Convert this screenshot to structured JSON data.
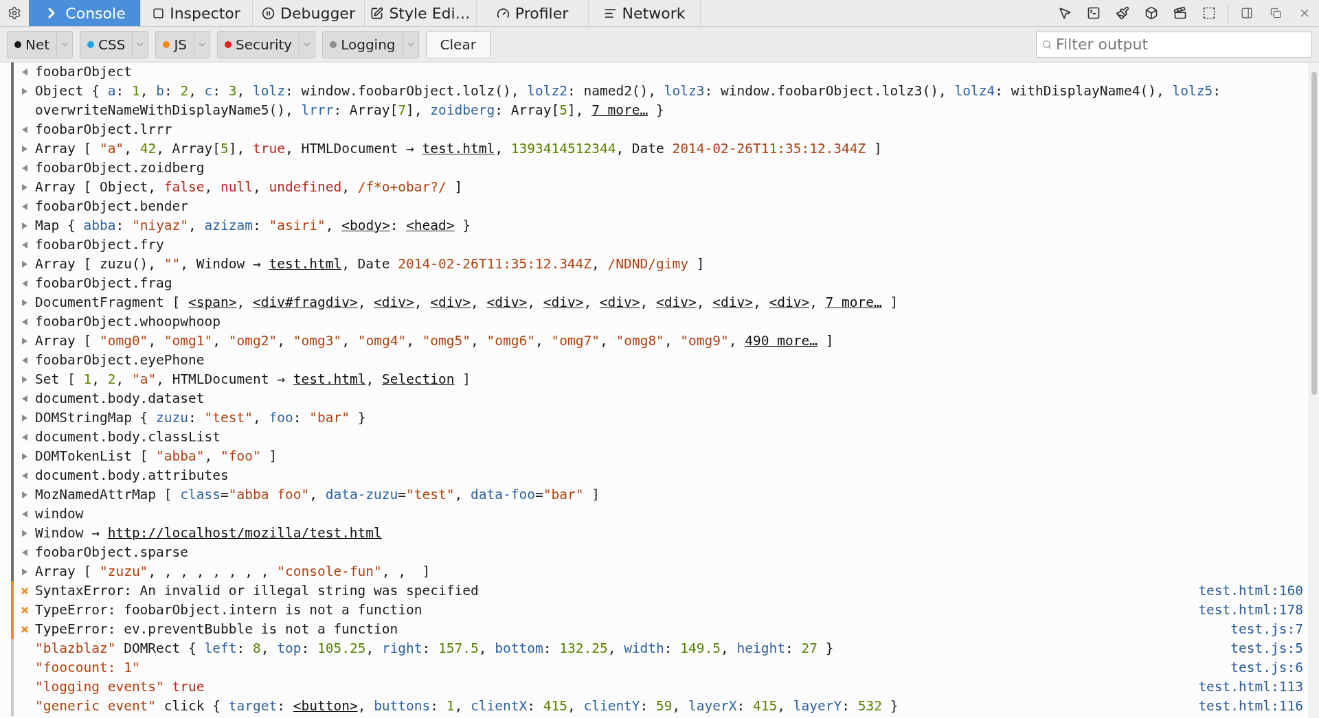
{
  "tabs": [
    {
      "label": "Console",
      "selected": true
    },
    {
      "label": "Inspector",
      "selected": false
    },
    {
      "label": "Debugger",
      "selected": false
    },
    {
      "label": "Style Edi…",
      "selected": false
    },
    {
      "label": "Profiler",
      "selected": false
    },
    {
      "label": "Network",
      "selected": false
    }
  ],
  "filters": [
    {
      "label": "Net",
      "color": "#1a1a1a"
    },
    {
      "label": "CSS",
      "color": "#1fa3e8"
    },
    {
      "label": "JS",
      "color": "#f08c1a"
    },
    {
      "label": "Security",
      "color": "#e8212b"
    },
    {
      "label": "Logging",
      "color": "#8c8c8c"
    }
  ],
  "clear_button": "Clear",
  "filter_field": {
    "placeholder": "Filter output"
  },
  "rows": [
    {
      "kind": "input",
      "parts": [
        {
          "text": "foobarObject"
        }
      ]
    },
    {
      "kind": "output",
      "parts": [
        {
          "text": "Object { "
        },
        {
          "key": "a"
        },
        {
          "text": ": "
        },
        {
          "number": "1"
        },
        {
          "text": ", "
        },
        {
          "key": "b"
        },
        {
          "text": ": "
        },
        {
          "number": "2"
        },
        {
          "text": ", "
        },
        {
          "key": "c"
        },
        {
          "text": ": "
        },
        {
          "number": "3"
        },
        {
          "text": ", "
        },
        {
          "key": "lolz"
        },
        {
          "text": ": window.foobarObject.lolz(), "
        },
        {
          "key": "lolz2"
        },
        {
          "text": ": named2(), "
        },
        {
          "key": "lolz3"
        },
        {
          "text": ": window.foobarObject.lolz3(), "
        },
        {
          "key": "lolz4"
        },
        {
          "text": ": withDisplayName4(), "
        },
        {
          "key": "lolz5"
        },
        {
          "text": ": overwriteNameWithDisplayName5(), "
        },
        {
          "key": "lrrr"
        },
        {
          "text": ": Array["
        },
        {
          "number": "7"
        },
        {
          "text": "], "
        },
        {
          "key": "zoidberg"
        },
        {
          "text": ": Array["
        },
        {
          "number": "5"
        },
        {
          "text": "], "
        },
        {
          "link": "7 more…"
        },
        {
          "text": " }"
        }
      ]
    },
    {
      "kind": "input",
      "parts": [
        {
          "text": "foobarObject.lrrr"
        }
      ]
    },
    {
      "kind": "output",
      "parts": [
        {
          "text": "Array [ "
        },
        {
          "string": "\"a\""
        },
        {
          "text": ", "
        },
        {
          "number": "42"
        },
        {
          "text": ", Array["
        },
        {
          "number": "5"
        },
        {
          "text": "], "
        },
        {
          "keyword": "true"
        },
        {
          "text": ", HTMLDocument → "
        },
        {
          "link": "test.html"
        },
        {
          "text": ", "
        },
        {
          "number": "1393414512344"
        },
        {
          "text": ", Date "
        },
        {
          "string": "2014-02-26T11:35:12.344Z"
        },
        {
          "text": " ]"
        }
      ]
    },
    {
      "kind": "input",
      "parts": [
        {
          "text": "foobarObject.zoidberg"
        }
      ]
    },
    {
      "kind": "output",
      "parts": [
        {
          "text": "Array [ Object, "
        },
        {
          "keyword": "false"
        },
        {
          "text": ", "
        },
        {
          "keyword": "null"
        },
        {
          "text": ", "
        },
        {
          "keyword": "undefined"
        },
        {
          "text": ", "
        },
        {
          "string": "/f*o+obar?/"
        },
        {
          "text": " ]"
        }
      ]
    },
    {
      "kind": "input",
      "parts": [
        {
          "text": "foobarObject.bender"
        }
      ]
    },
    {
      "kind": "output",
      "parts": [
        {
          "text": "Map { "
        },
        {
          "key": "abba"
        },
        {
          "text": ": "
        },
        {
          "string": "\"niyaz\""
        },
        {
          "text": ", "
        },
        {
          "key": "azizam"
        },
        {
          "text": ": "
        },
        {
          "string": "\"asiri\""
        },
        {
          "text": ", "
        },
        {
          "link": "<body>"
        },
        {
          "text": ": "
        },
        {
          "link": "<head>"
        },
        {
          "text": " }"
        }
      ]
    },
    {
      "kind": "input",
      "parts": [
        {
          "text": "foobarObject.fry"
        }
      ]
    },
    {
      "kind": "output",
      "parts": [
        {
          "text": "Array [ zuzu(), "
        },
        {
          "string": "\"\""
        },
        {
          "text": ", Window → "
        },
        {
          "link": "test.html"
        },
        {
          "text": ", Date "
        },
        {
          "string": "2014-02-26T11:35:12.344Z"
        },
        {
          "text": ", "
        },
        {
          "string": "/NDND/gimy"
        },
        {
          "text": " ]"
        }
      ]
    },
    {
      "kind": "input",
      "parts": [
        {
          "text": "foobarObject.frag"
        }
      ]
    },
    {
      "kind": "output",
      "parts": [
        {
          "text": "DocumentFragment [ "
        },
        {
          "link": "<span>"
        },
        {
          "text": ", "
        },
        {
          "link": "<div#fragdiv>"
        },
        {
          "text": ", "
        },
        {
          "link": "<div>"
        },
        {
          "text": ", "
        },
        {
          "link": "<div>"
        },
        {
          "text": ", "
        },
        {
          "link": "<div>"
        },
        {
          "text": ", "
        },
        {
          "link": "<div>"
        },
        {
          "text": ", "
        },
        {
          "link": "<div>"
        },
        {
          "text": ", "
        },
        {
          "link": "<div>"
        },
        {
          "text": ", "
        },
        {
          "link": "<div>"
        },
        {
          "text": ", "
        },
        {
          "link": "<div>"
        },
        {
          "text": ", "
        },
        {
          "link": "7 more…"
        },
        {
          "text": " ]"
        }
      ]
    },
    {
      "kind": "input",
      "parts": [
        {
          "text": "foobarObject.whoopwhoop"
        }
      ]
    },
    {
      "kind": "output",
      "parts": [
        {
          "text": "Array [ "
        },
        {
          "string": "\"omg0\""
        },
        {
          "text": ", "
        },
        {
          "string": "\"omg1\""
        },
        {
          "text": ", "
        },
        {
          "string": "\"omg2\""
        },
        {
          "text": ", "
        },
        {
          "string": "\"omg3\""
        },
        {
          "text": ", "
        },
        {
          "string": "\"omg4\""
        },
        {
          "text": ", "
        },
        {
          "string": "\"omg5\""
        },
        {
          "text": ", "
        },
        {
          "string": "\"omg6\""
        },
        {
          "text": ", "
        },
        {
          "string": "\"omg7\""
        },
        {
          "text": ", "
        },
        {
          "string": "\"omg8\""
        },
        {
          "text": ", "
        },
        {
          "string": "\"omg9\""
        },
        {
          "text": ", "
        },
        {
          "link": "490 more…"
        },
        {
          "text": " ]"
        }
      ]
    },
    {
      "kind": "input",
      "parts": [
        {
          "text": "foobarObject.eyePhone"
        }
      ]
    },
    {
      "kind": "output",
      "parts": [
        {
          "text": "Set [ "
        },
        {
          "number": "1"
        },
        {
          "text": ", "
        },
        {
          "number": "2"
        },
        {
          "text": ", "
        },
        {
          "string": "\"a\""
        },
        {
          "text": ", HTMLDocument → "
        },
        {
          "link": "test.html"
        },
        {
          "text": ", "
        },
        {
          "link": "Selection"
        },
        {
          "text": " ]"
        }
      ]
    },
    {
      "kind": "input",
      "parts": [
        {
          "text": "document.body.dataset"
        }
      ]
    },
    {
      "kind": "output",
      "parts": [
        {
          "text": "DOMStringMap { "
        },
        {
          "key": "zuzu"
        },
        {
          "text": ": "
        },
        {
          "string": "\"test\""
        },
        {
          "text": ", "
        },
        {
          "key": "foo"
        },
        {
          "text": ": "
        },
        {
          "string": "\"bar\""
        },
        {
          "text": " }"
        }
      ]
    },
    {
      "kind": "input",
      "parts": [
        {
          "text": "document.body.classList"
        }
      ]
    },
    {
      "kind": "output",
      "parts": [
        {
          "text": "DOMTokenList [ "
        },
        {
          "string": "\"abba\""
        },
        {
          "text": ", "
        },
        {
          "string": "\"foo\""
        },
        {
          "text": " ]"
        }
      ]
    },
    {
      "kind": "input",
      "parts": [
        {
          "text": "document.body.attributes"
        }
      ]
    },
    {
      "kind": "output",
      "parts": [
        {
          "text": "MozNamedAttrMap [ "
        },
        {
          "key": "class"
        },
        {
          "text": "="
        },
        {
          "string": "\"abba foo\""
        },
        {
          "text": ", "
        },
        {
          "key": "data-zuzu"
        },
        {
          "text": "="
        },
        {
          "string": "\"test\""
        },
        {
          "text": ", "
        },
        {
          "key": "data-foo"
        },
        {
          "text": "="
        },
        {
          "string": "\"bar\""
        },
        {
          "text": " ]"
        }
      ]
    },
    {
      "kind": "input",
      "parts": [
        {
          "text": "window"
        }
      ]
    },
    {
      "kind": "output",
      "parts": [
        {
          "text": "Window → "
        },
        {
          "link": "http://localhost/mozilla/test.html"
        }
      ]
    },
    {
      "kind": "input",
      "parts": [
        {
          "text": "foobarObject.sparse"
        }
      ]
    },
    {
      "kind": "output",
      "parts": [
        {
          "text": "Array [ "
        },
        {
          "string": "\"zuzu\""
        },
        {
          "text": ", , , , , , , , "
        },
        {
          "string": "\"console-fun\""
        },
        {
          "text": ", ,  ]"
        }
      ]
    },
    {
      "kind": "error",
      "parts": [
        {
          "text": "SyntaxError: An invalid or illegal string was specified"
        }
      ],
      "location": "test.html:160"
    },
    {
      "kind": "error",
      "parts": [
        {
          "text": "TypeError: foobarObject.intern is not a function"
        }
      ],
      "location": "test.html:178"
    },
    {
      "kind": "error",
      "parts": [
        {
          "text": "TypeError: ev.preventBubble is not a function"
        }
      ],
      "location": "test.js:7"
    },
    {
      "kind": "log",
      "parts": [
        {
          "string": "\"blazblaz\""
        },
        {
          "text": " DOMRect { "
        },
        {
          "key": "left"
        },
        {
          "text": ": "
        },
        {
          "number": "8"
        },
        {
          "text": ", "
        },
        {
          "key": "top"
        },
        {
          "text": ": "
        },
        {
          "number": "105.25"
        },
        {
          "text": ", "
        },
        {
          "key": "right"
        },
        {
          "text": ": "
        },
        {
          "number": "157.5"
        },
        {
          "text": ", "
        },
        {
          "key": "bottom"
        },
        {
          "text": ": "
        },
        {
          "number": "132.25"
        },
        {
          "text": ", "
        },
        {
          "key": "width"
        },
        {
          "text": ": "
        },
        {
          "number": "149.5"
        },
        {
          "text": ", "
        },
        {
          "key": "height"
        },
        {
          "text": ": "
        },
        {
          "number": "27"
        },
        {
          "text": " }"
        }
      ],
      "location": "test.js:5"
    },
    {
      "kind": "log",
      "parts": [
        {
          "string": "\"foocount: 1\""
        }
      ],
      "location": "test.js:6"
    },
    {
      "kind": "log",
      "parts": [
        {
          "string": "\"logging events\" "
        },
        {
          "keyword": "true"
        }
      ],
      "location": "test.html:113"
    },
    {
      "kind": "log",
      "parts": [
        {
          "string": "\"generic event\""
        },
        {
          "text": " click { "
        },
        {
          "key": "target"
        },
        {
          "text": ": "
        },
        {
          "link": "<button>"
        },
        {
          "text": ", "
        },
        {
          "key": "buttons"
        },
        {
          "text": ": "
        },
        {
          "number": "1"
        },
        {
          "text": ", "
        },
        {
          "key": "clientX"
        },
        {
          "text": ": "
        },
        {
          "number": "415"
        },
        {
          "text": ", "
        },
        {
          "key": "clientY"
        },
        {
          "text": ": "
        },
        {
          "number": "59"
        },
        {
          "text": ", "
        },
        {
          "key": "layerX"
        },
        {
          "text": ": "
        },
        {
          "number": "415"
        },
        {
          "text": ", "
        },
        {
          "key": "layerY"
        },
        {
          "text": ": "
        },
        {
          "number": "532"
        },
        {
          "text": " }"
        }
      ],
      "location": "test.html:116"
    }
  ]
}
